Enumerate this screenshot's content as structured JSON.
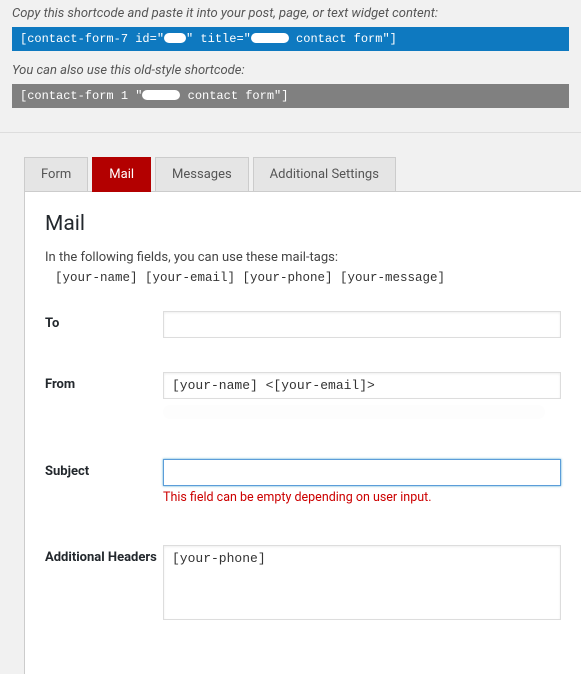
{
  "shortcode": {
    "intro_primary": "Copy this shortcode and paste it into your post, page, or text widget content:",
    "primary_prefix": "[contact-form-7 id=\"",
    "primary_mid": "\" title=\"",
    "primary_suffix": " contact form\"]",
    "intro_secondary": "You can also use this old-style shortcode:",
    "secondary_prefix": "[contact-form 1 \"",
    "secondary_suffix": " contact form\"]"
  },
  "tabs": {
    "form": "Form",
    "mail": "Mail",
    "messages": "Messages",
    "additional": "Additional Settings"
  },
  "panel": {
    "title": "Mail",
    "desc": "In the following fields, you can use these mail-tags:",
    "tags": "[your-name] [your-email] [your-phone] [your-message]"
  },
  "fields": {
    "to_label": "To",
    "to_value": "",
    "from_label": "From",
    "from_value": "[your-name] <[your-email]>",
    "subject_label": "Subject",
    "subject_value": "",
    "subject_error": "This field can be empty depending on user input.",
    "headers_label": "Additional Headers",
    "headers_value": "[your-phone]"
  }
}
